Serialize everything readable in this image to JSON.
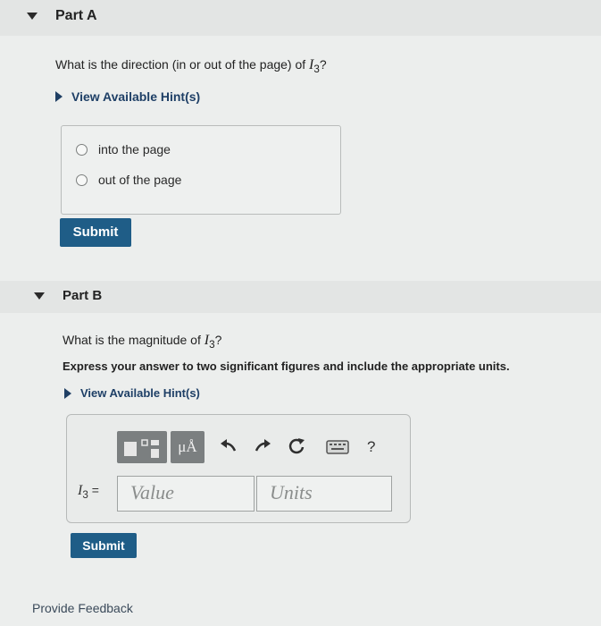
{
  "partA": {
    "title": "Part A",
    "question_prefix": "What is the direction (in or out of the page) of ",
    "variable": "I",
    "subscript": "3",
    "question_suffix": "?",
    "hint_label": "View Available Hint(s)",
    "options": [
      "into the page",
      "out of the page"
    ],
    "submit_label": "Submit"
  },
  "partB": {
    "title": "Part B",
    "question_prefix": "What is the magnitude of ",
    "variable": "I",
    "subscript": "3",
    "question_suffix": "?",
    "instruction": "Express your answer to two significant figures and include the appropriate units.",
    "hint_label": "View Available Hint(s)",
    "units_symbol": "μÅ",
    "help_symbol": "?",
    "input_label_var": "I",
    "input_label_sub": "3",
    "input_label_eq": " =",
    "value_placeholder": "Value",
    "units_placeholder": "Units",
    "submit_label": "Submit"
  },
  "footer": {
    "feedback_label": "Provide Feedback"
  },
  "colors": {
    "button": "#1f5d87",
    "hint": "#1e3f66",
    "toolbar": "#7b7f80"
  }
}
